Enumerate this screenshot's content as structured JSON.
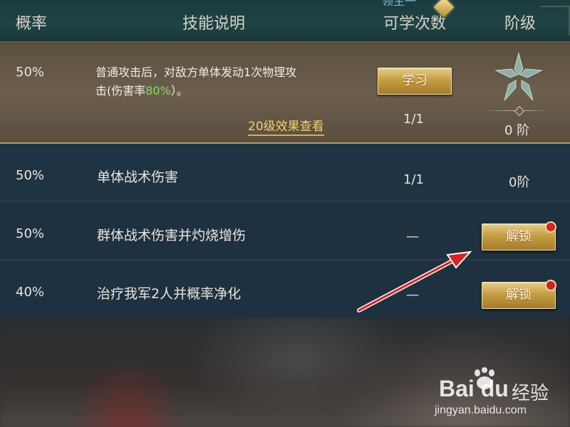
{
  "header": {
    "top_badge": "领主一",
    "columns": {
      "probability": "概率",
      "skill_desc": "技能说明",
      "learn_count": "可学次数",
      "rank": "阶级"
    }
  },
  "rows": [
    {
      "probability": "50%",
      "description_line1": "普通攻击后，对敌方单体发动1次物理攻",
      "description_line2_prefix": "击(伤害率",
      "description_highlight": "80%",
      "description_line2_suffix": "）。",
      "effect_link": "20级效果查看",
      "learn_button": "学习",
      "learn_count": "1/1",
      "rank": "0 阶"
    },
    {
      "probability": "50%",
      "description": "单体战术伤害",
      "learn_count": "1/1",
      "rank": "0阶"
    },
    {
      "probability": "50%",
      "description": "群体战术伤害并灼烧增伤",
      "learn_count": "—",
      "unlock_button": "解锁"
    },
    {
      "probability": "40%",
      "description": "治疗我军2人并概率净化",
      "learn_count": "—",
      "unlock_button": "解锁"
    }
  ],
  "watermark": {
    "logo": "Bai du",
    "site_cn": "经验",
    "url": "jingyan.baidu.com"
  },
  "colors": {
    "highlight_green": "#7ee05a",
    "gold_button": "#c59e45",
    "notification_dot": "#d32323",
    "arrow_red": "#e02020"
  }
}
